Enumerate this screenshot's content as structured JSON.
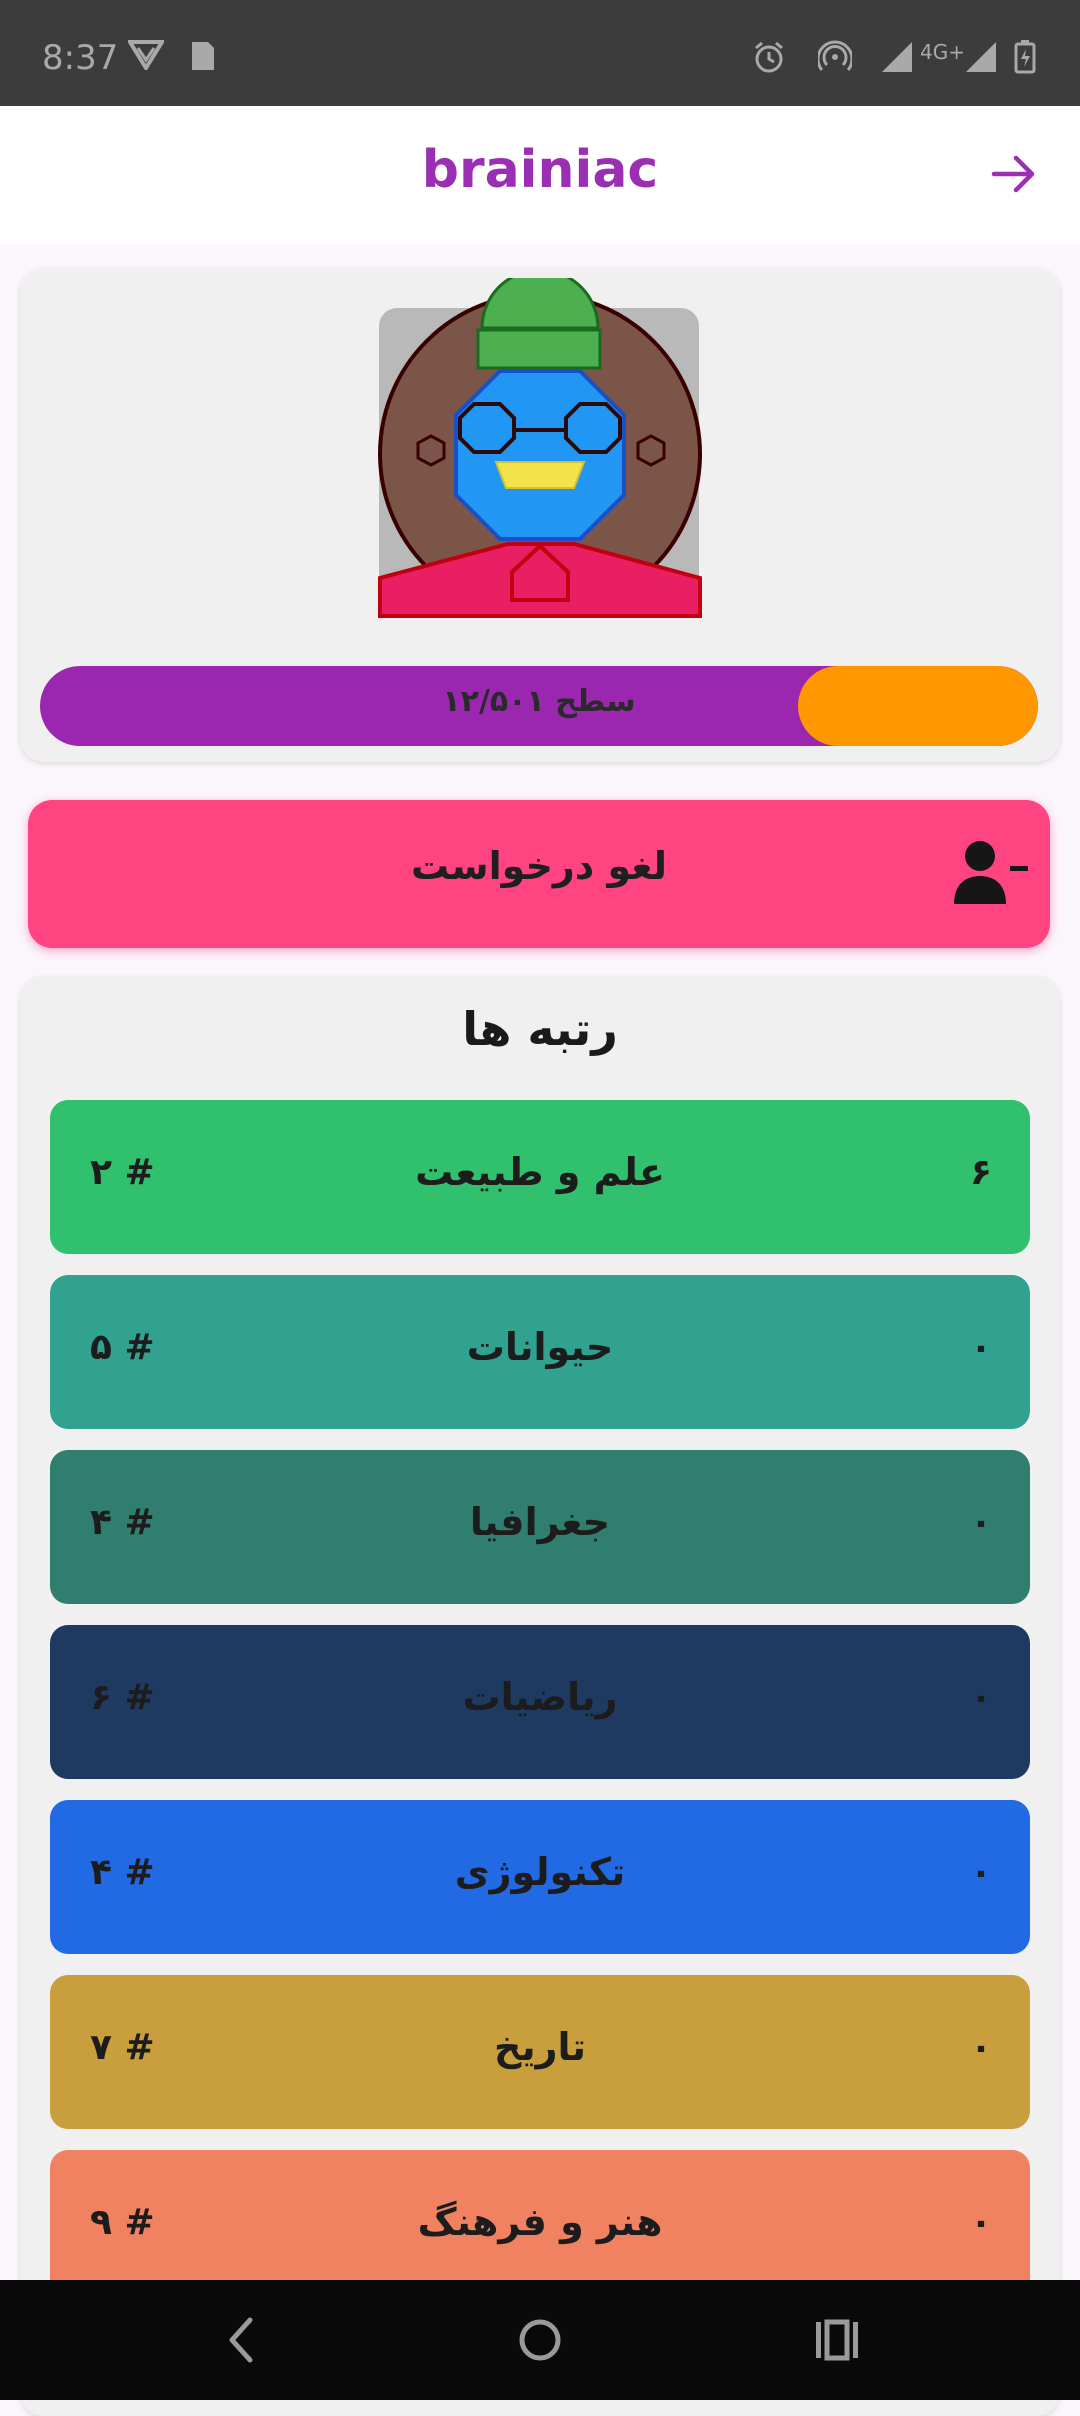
{
  "status_bar": {
    "time": "8:37",
    "network": "4G+"
  },
  "app_bar": {
    "title": "brainiac"
  },
  "profile": {
    "level_label": "سطح ۱۲/۵۰۱",
    "level_progress": 0.76
  },
  "cancel_request": {
    "label": "لغو درخواست"
  },
  "ranks": {
    "title": "رتبه ها",
    "items": [
      {
        "name": "علم و طبیعت",
        "score": "۶",
        "position": "# ۲",
        "color": "#31c06e"
      },
      {
        "name": "حیوانات",
        "score": "۰",
        "position": "# ۵",
        "color": "#31a28f"
      },
      {
        "name": "جغرافیا",
        "score": "۰",
        "position": "# ۴",
        "color": "#2f7e6f"
      },
      {
        "name": "ریاضیات",
        "score": "۰",
        "position": "# ۶",
        "color": "#1f3a61"
      },
      {
        "name": "تکنولوژی",
        "score": "۰",
        "position": "# ۴",
        "color": "#216ae3"
      },
      {
        "name": "تاریخ",
        "score": "۰",
        "position": "# ۷",
        "color": "#c99e3c"
      },
      {
        "name": "هنر و فرهنگ",
        "score": "۰",
        "position": "# ۹",
        "color": "#f08262"
      }
    ]
  },
  "colors": {
    "accent": "#9b2fb3",
    "level_fill": "#ff9800",
    "cancel": "#ff4481"
  }
}
